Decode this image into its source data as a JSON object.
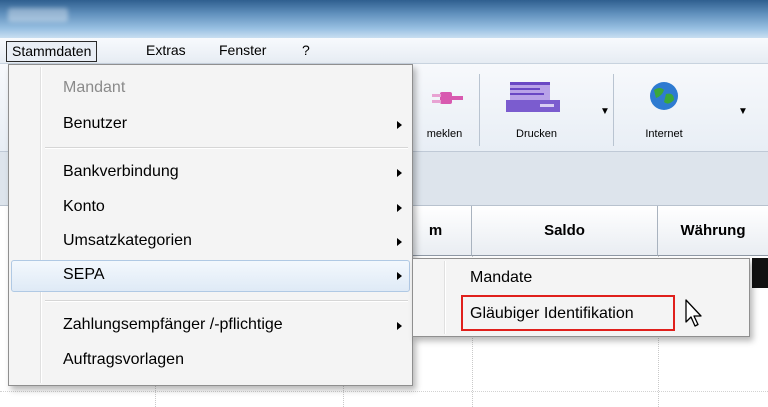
{
  "menubar": {
    "items": [
      {
        "label": "Stammdaten"
      },
      {
        "label": "Extras"
      },
      {
        "label": "Fenster"
      },
      {
        "label": "?"
      }
    ]
  },
  "toolbar": {
    "buttons": [
      {
        "label": "meklen",
        "icon": "plug-icon"
      },
      {
        "label": "Drucken",
        "icon": "printer-icon"
      },
      {
        "label": "Internet",
        "icon": "globe-icon"
      }
    ]
  },
  "table": {
    "headers": [
      "m",
      "Saldo",
      "Währung"
    ]
  },
  "dropdown": {
    "items": [
      {
        "label": "Mandant",
        "disabled": true,
        "submenu": false
      },
      {
        "label": "Benutzer",
        "disabled": false,
        "submenu": true
      },
      {
        "label": "Bankverbindung",
        "disabled": false,
        "submenu": true
      },
      {
        "label": "Konto",
        "disabled": false,
        "submenu": true
      },
      {
        "label": "Umsatzkategorien",
        "disabled": false,
        "submenu": true
      },
      {
        "label": "SEPA",
        "disabled": false,
        "submenu": true,
        "hovered": true
      },
      {
        "label": "Zahlungsempfänger /-pflichtige",
        "disabled": false,
        "submenu": true
      },
      {
        "label": "Auftragsvorlagen",
        "disabled": false,
        "submenu": false
      }
    ]
  },
  "submenu": {
    "items": [
      {
        "label": "Mandate"
      },
      {
        "label": "Gläubiger Identifikation",
        "highlighted": true
      }
    ],
    "highlight_color": "#e0201c"
  }
}
